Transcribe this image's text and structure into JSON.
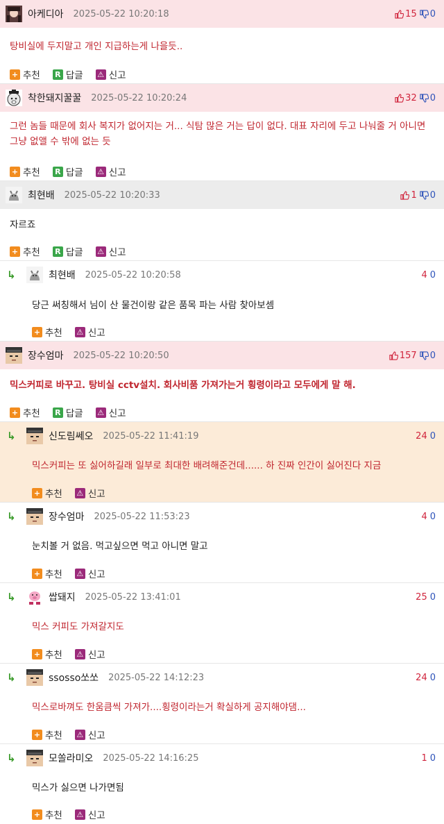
{
  "labels": {
    "recommend": "추천",
    "reply": "답글",
    "report": "신고",
    "recommend_icon": "+",
    "reply_icon": "R",
    "report_icon": "⚠"
  },
  "colors": {
    "highlight_pink": "#fbe3e6",
    "reply_highlight": "#fcebd8",
    "up_red": "#d0243c",
    "down_blue": "#2c52b9",
    "reply_green": "#3a9b2a"
  },
  "comments": [
    {
      "nick": "아케디아",
      "date": "2025-05-22 10:20:18",
      "up": "15",
      "down": "0",
      "text": "탕비실에 두지말고 개인 지급하는게 나을듯.."
    },
    {
      "nick": "착한돼지꿀꿀",
      "date": "2025-05-22 10:20:24",
      "up": "32",
      "down": "0",
      "text": "그런 놈들 때문에 회사 복지가 없어지는 거... 식탐 많은 거는 답이 없다. 대표 자리에 두고 나눠줄 거 아니면 그냥 없앨 수 밖에 없는 듯"
    },
    {
      "nick": "최현배",
      "date": "2025-05-22 10:20:33",
      "up": "1",
      "down": "0",
      "text": "자르죠"
    },
    {
      "nick": "최현배",
      "date": "2025-05-22 10:20:58",
      "up": "4",
      "down": "0",
      "text": "당근 써칭해서 님이 산 물건이랑 같은 품목 파는 사람 찾아보셈"
    },
    {
      "nick": "장수엄마",
      "date": "2025-05-22 10:20:50",
      "up": "157",
      "down": "0",
      "text": "믹스커피로 바꾸고. 탕비실 cctv설치. 회사비품 가져가는거 횡령이라고 모두에게 말 해."
    },
    {
      "nick": "신도림쎄오",
      "date": "2025-05-22 11:41:19",
      "up": "24",
      "down": "0",
      "text": "믹스커피는 또 싫어하길래 일부로 최대한 배려해준건데...... 하 진짜 인간이 싫어진다 지금"
    },
    {
      "nick": "장수엄마",
      "date": "2025-05-22 11:53:23",
      "up": "4",
      "down": "0",
      "text": "눈치볼 거 없음. 먹고싶으면 먹고 아니면 말고"
    },
    {
      "nick": "쌉돼지",
      "date": "2025-05-22 13:41:01",
      "up": "25",
      "down": "0",
      "text": "믹스 커피도 가져갈지도"
    },
    {
      "nick": "ssosso쏘쏘",
      "date": "2025-05-22 14:12:23",
      "up": "24",
      "down": "0",
      "text": "믹스로바껴도 한움큼씩 가져가....횡령이라는거 확실하게 공지해야댐..."
    },
    {
      "nick": "모쏠라미오",
      "date": "2025-05-22 14:16:25",
      "up": "1",
      "down": "0",
      "text": "믹스가 싫으면 나가면됨"
    }
  ]
}
